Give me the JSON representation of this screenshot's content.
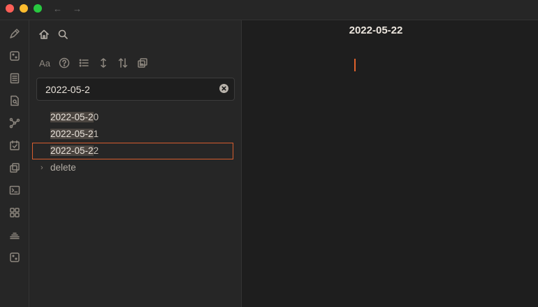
{
  "window": {
    "nav_back": "←",
    "nav_forward": "→"
  },
  "ribbon": {
    "icons": [
      "pen-icon",
      "dice-icon",
      "file-list-icon",
      "file-search-icon",
      "graph-icon",
      "calendar-check-icon",
      "copy-icon",
      "terminal-icon",
      "grid-icon",
      "layers-icon",
      "dice-icon"
    ]
  },
  "sidebar": {
    "search": {
      "value": "2022-05-2"
    },
    "results": [
      {
        "match": "2022-05-2",
        "rest": "0"
      },
      {
        "match": "2022-05-2",
        "rest": "1"
      },
      {
        "match": "2022-05-2",
        "rest": "2"
      }
    ],
    "folder": {
      "label": "delete",
      "chevron": "›"
    },
    "tools": {
      "font_label": "Aa"
    }
  },
  "editor": {
    "title": "2022-05-22"
  },
  "colors": {
    "accent": "#d65d2f",
    "background": "#1e1e1e",
    "panel": "#262626"
  }
}
